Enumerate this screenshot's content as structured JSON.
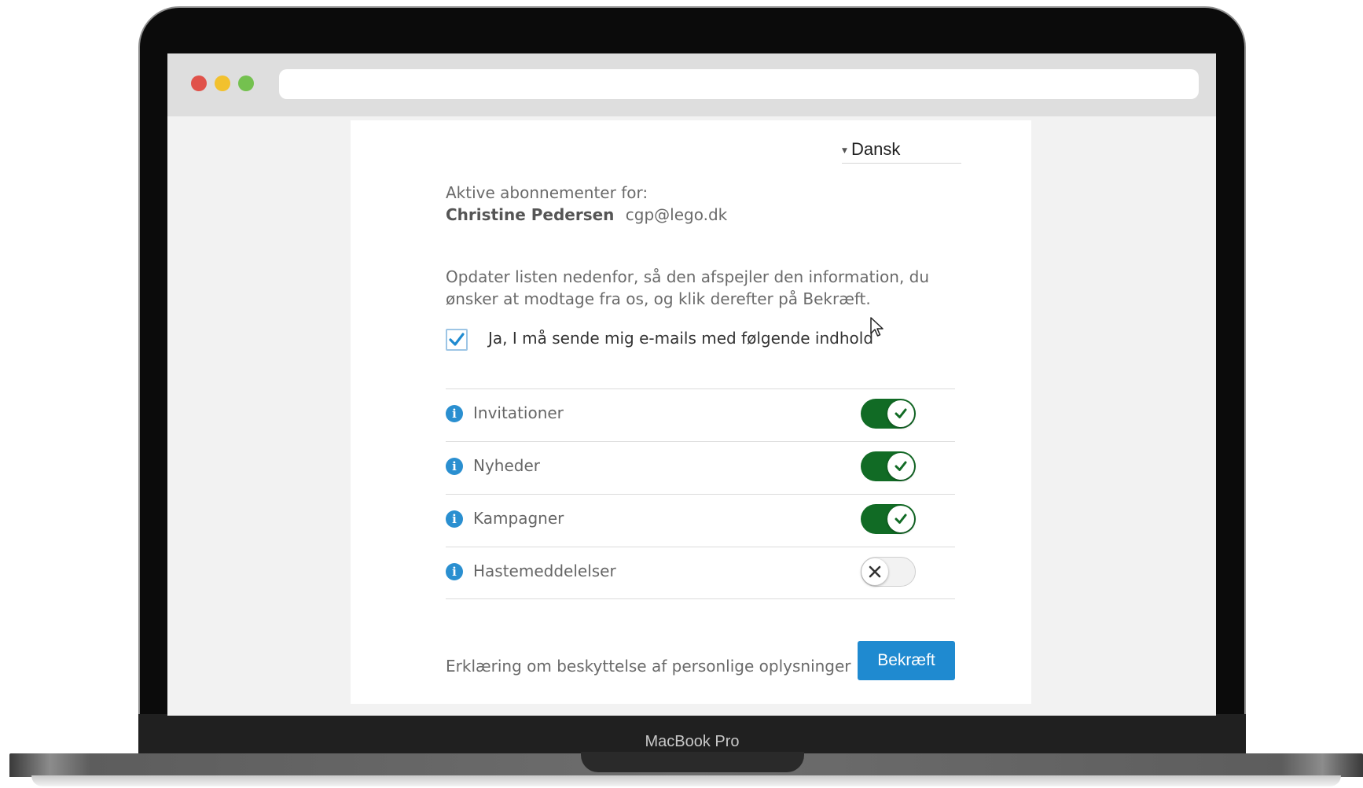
{
  "device": {
    "model_label": "MacBook Pro"
  },
  "language_selector": {
    "value": "Dansk"
  },
  "subscriptions_intro": {
    "label": "Aktive abonnementer for:",
    "user_name": "Christine Pedersen",
    "user_email": "cgp@lego.dk"
  },
  "instructions": "Opdater listen nedenfor, så den afspejler den information, du ønsker at modtage fra os, og klik derefter på Bekræft.",
  "consent": {
    "label": "Ja, I må sende mig e-mails med følgende indhold",
    "checked": true
  },
  "preferences": [
    {
      "label": "Invitationer",
      "enabled": true,
      "icon": "info-icon"
    },
    {
      "label": "Nyheder",
      "enabled": true,
      "icon": "info-icon"
    },
    {
      "label": "Kampagner",
      "enabled": true,
      "icon": "info-icon"
    },
    {
      "label": "Hastemeddelelser",
      "enabled": false,
      "icon": "info-icon"
    }
  ],
  "footer": {
    "privacy_link": "Erklæring om beskyttelse af personlige oplysninger",
    "confirm_button": "Bekræft"
  },
  "colors": {
    "toggle_on": "#116b25",
    "accent_blue": "#1f8ad0"
  }
}
